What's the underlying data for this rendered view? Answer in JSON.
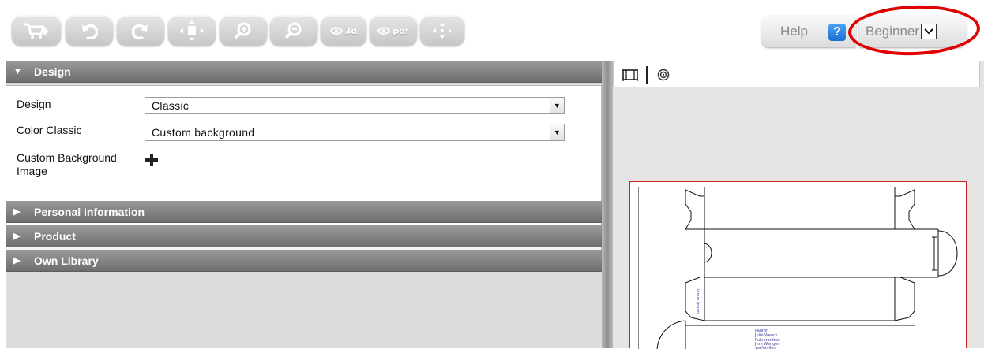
{
  "toolbar": {
    "buttons": [
      {
        "name": "add-to-cart-button",
        "icon": "cart-plus-icon"
      },
      {
        "name": "undo-button",
        "icon": "undo-icon"
      },
      {
        "name": "redo-button",
        "icon": "redo-icon"
      },
      {
        "name": "fit-to-screen-button",
        "icon": "move-arrows-icon"
      },
      {
        "name": "zoom-in-button",
        "icon": "zoom-in-icon"
      },
      {
        "name": "zoom-out-button",
        "icon": "zoom-out-icon"
      },
      {
        "name": "preview-3d-button",
        "icon": "eye-icon",
        "label": "3d"
      },
      {
        "name": "preview-pdf-button",
        "icon": "eye-icon",
        "label": "pdf"
      },
      {
        "name": "drag-button",
        "icon": "drag-arrows-icon"
      }
    ],
    "help_label": "Help",
    "help_icon_glyph": "?",
    "level_label": "Beginner",
    "accent_color": "#1a6fd1",
    "highlight_color": "#e00000"
  },
  "sections": [
    {
      "label": "Design",
      "state": "expanded"
    },
    {
      "label": "Personal information",
      "state": "collapsed"
    },
    {
      "label": "Product",
      "state": "collapsed"
    },
    {
      "label": "Own Library",
      "state": "collapsed"
    }
  ],
  "design": {
    "fields": [
      {
        "label": "Design",
        "value": "Classic"
      },
      {
        "label": "Color Classic",
        "value": "Custom background"
      }
    ],
    "custom_bg_label_line1": "Custom Background",
    "custom_bg_label_line2": "Image"
  },
  "preview": {
    "label_text": [
      "Pagron",
      "Julie Wenck",
      "Pulverordnet",
      "Jhre Wangen",
      "verfeinllen"
    ],
    "side_text": "lorem ipsum"
  }
}
